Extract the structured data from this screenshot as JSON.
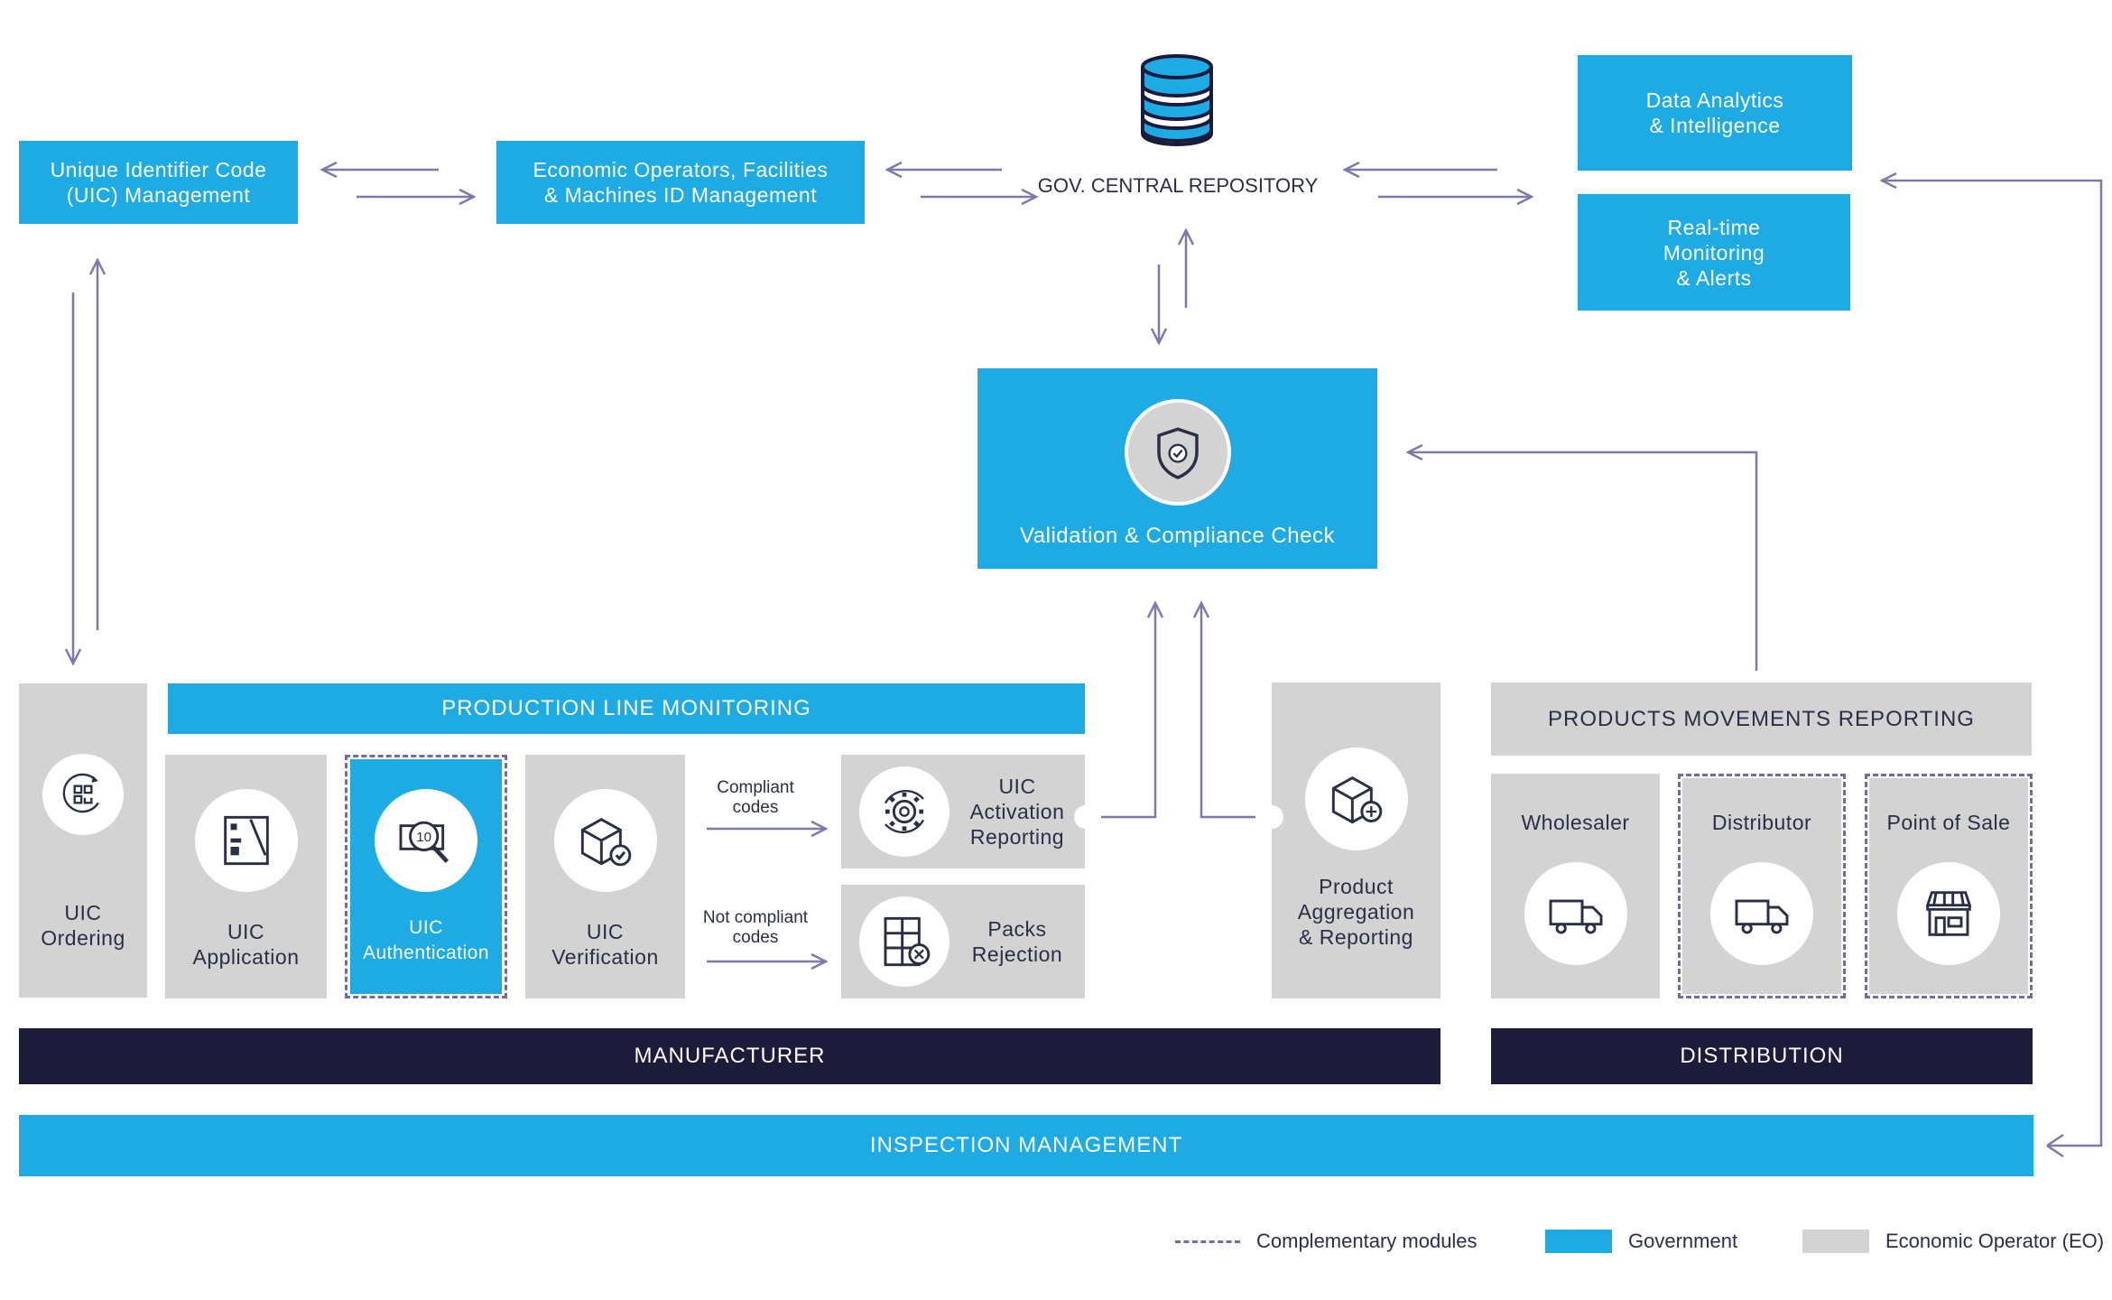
{
  "colors": {
    "government": "#1eabe3",
    "economic_operator": "#d3d3d3",
    "dark": "#1c1b3a",
    "arrow": "#7c79ab"
  },
  "top": {
    "uic_management": "Unique Identifier Code\n(UIC) Management",
    "eo_id_management": "Economic Operators, Facilities\n& Machines ID Management",
    "repository": "GOV. CENTRAL REPOSITORY",
    "analytics": "Data Analytics\n& Intelligence",
    "monitoring": "Real-time\nMonitoring\n& Alerts"
  },
  "validation": {
    "label": "Validation & Compliance Check",
    "icon": "shield-check-icon"
  },
  "manufacturer": {
    "production_header": "PRODUCTION LINE MONITORING",
    "ordering": "UIC\nOrdering",
    "application": "UIC\nApplication",
    "authentication": "UIC\nAuthentication",
    "verification": "UIC\nVerification",
    "compliant": "Compliant\ncodes",
    "not_compliant": "Not compliant\ncodes",
    "activation": "UIC\nActivation\nReporting",
    "rejection": "Packs\nRejection",
    "aggregation": "Product\nAggregation\n& Reporting",
    "footer": "MANUFACTURER"
  },
  "distribution": {
    "header": "PRODUCTS  MOVEMENTS REPORTING",
    "wholesaler": "Wholesaler",
    "distributor": "Distributor",
    "pos": "Point of Sale",
    "footer": "DISTRIBUTION"
  },
  "inspection": "INSPECTION MANAGEMENT",
  "legend": {
    "complementary": "Complementary modules",
    "government": "Government",
    "eo": "Economic Operator (EO)"
  }
}
